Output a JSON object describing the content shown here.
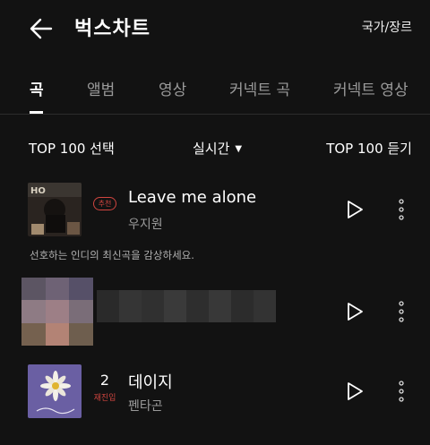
{
  "header": {
    "title": "벅스차트",
    "country_genre": "국가/장르"
  },
  "tabs": [
    {
      "label": "곡",
      "active": true
    },
    {
      "label": "앨범",
      "active": false
    },
    {
      "label": "영상",
      "active": false
    },
    {
      "label": "커넥트 곡",
      "active": false
    },
    {
      "label": "커넥트 영상",
      "active": false
    }
  ],
  "controls": {
    "select_top100": "TOP 100 선택",
    "period": "실시간",
    "listen_top100": "TOP 100 듣기"
  },
  "tracks": [
    {
      "badge": "추천",
      "title": "Leave me alone",
      "artist": "우지원"
    },
    {
      "rank": "",
      "title": "",
      "artist": "",
      "blurred": true
    },
    {
      "rank": "2",
      "status": "재진입",
      "title": "데이지",
      "artist": "펜타곤"
    }
  ],
  "recommend_note": "선호하는 인디의 최신곡을 감상하세요.",
  "colors": {
    "background": "#121212",
    "accent": "#d0453f",
    "muted": "#9a9a9a"
  },
  "icons": {
    "back": "arrow-left-icon",
    "play": "play-icon",
    "more": "more-vertical-icon",
    "dropdown": "caret-down-icon"
  }
}
